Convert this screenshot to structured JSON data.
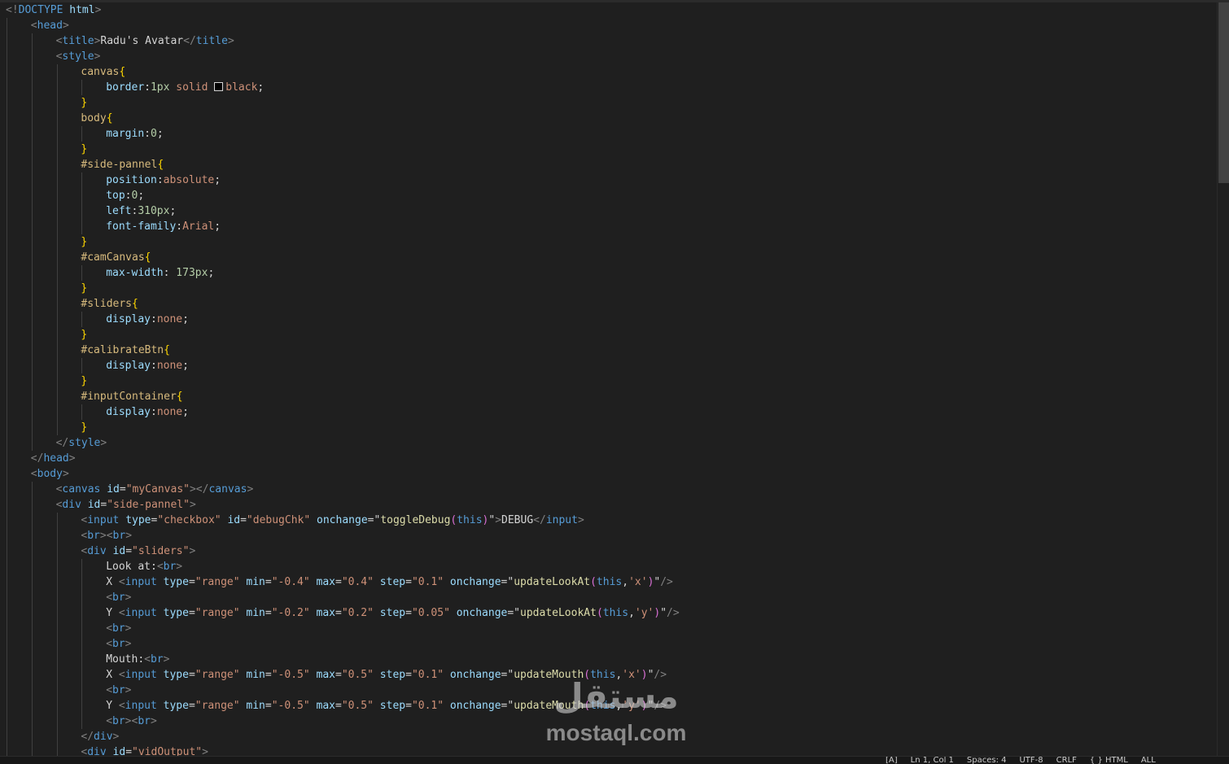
{
  "editor": {
    "lines": [
      [
        [
          "punc",
          "<!"
        ],
        [
          "tag",
          "DOCTYPE"
        ],
        [
          "text",
          " "
        ],
        [
          "attr",
          "html"
        ],
        [
          "punc",
          ">"
        ]
      ],
      [
        [
          "punc",
          "<"
        ],
        [
          "tag",
          "head"
        ],
        [
          "punc",
          ">"
        ]
      ],
      [
        [
          "punc",
          "<"
        ],
        [
          "tag",
          "title"
        ],
        [
          "punc",
          ">"
        ],
        [
          "text",
          "Radu's Avatar"
        ],
        [
          "punc",
          "</"
        ],
        [
          "tag",
          "title"
        ],
        [
          "punc",
          ">"
        ]
      ],
      [
        [
          "punc",
          "<"
        ],
        [
          "tag",
          "style"
        ],
        [
          "punc",
          ">"
        ]
      ],
      [
        [
          "sel",
          "canvas"
        ],
        [
          "brace",
          "{"
        ]
      ],
      [
        [
          "prop",
          "border"
        ],
        [
          "text",
          ":"
        ],
        [
          "num",
          "1px"
        ],
        [
          "text",
          " "
        ],
        [
          "val",
          "solid"
        ],
        [
          "text",
          " "
        ],
        [
          "swatch",
          ""
        ],
        [
          "val",
          "black"
        ],
        [
          "text",
          ";"
        ]
      ],
      [
        [
          "brace",
          "}"
        ]
      ],
      [
        [
          "sel",
          "body"
        ],
        [
          "brace",
          "{"
        ]
      ],
      [
        [
          "prop",
          "margin"
        ],
        [
          "text",
          ":"
        ],
        [
          "num",
          "0"
        ],
        [
          "text",
          ";"
        ]
      ],
      [
        [
          "brace",
          "}"
        ]
      ],
      [
        [
          "sel",
          "#side-pannel"
        ],
        [
          "brace",
          "{"
        ]
      ],
      [
        [
          "prop",
          "position"
        ],
        [
          "text",
          ":"
        ],
        [
          "val",
          "absolute"
        ],
        [
          "text",
          ";"
        ]
      ],
      [
        [
          "prop",
          "top"
        ],
        [
          "text",
          ":"
        ],
        [
          "num",
          "0"
        ],
        [
          "text",
          ";"
        ]
      ],
      [
        [
          "prop",
          "left"
        ],
        [
          "text",
          ":"
        ],
        [
          "num",
          "310px"
        ],
        [
          "text",
          ";"
        ]
      ],
      [
        [
          "prop",
          "font-family"
        ],
        [
          "text",
          ":"
        ],
        [
          "val",
          "Arial"
        ],
        [
          "text",
          ";"
        ]
      ],
      [
        [
          "brace",
          "}"
        ]
      ],
      [
        [
          "sel",
          "#camCanvas"
        ],
        [
          "brace",
          "{"
        ]
      ],
      [
        [
          "prop",
          "max-width"
        ],
        [
          "text",
          ": "
        ],
        [
          "num",
          "173px"
        ],
        [
          "text",
          ";"
        ]
      ],
      [
        [
          "brace",
          "}"
        ]
      ],
      [
        [
          "sel",
          "#sliders"
        ],
        [
          "brace",
          "{"
        ]
      ],
      [
        [
          "prop",
          "display"
        ],
        [
          "text",
          ":"
        ],
        [
          "val",
          "none"
        ],
        [
          "text",
          ";"
        ]
      ],
      [
        [
          "brace",
          "}"
        ]
      ],
      [
        [
          "sel",
          "#calibrateBtn"
        ],
        [
          "brace",
          "{"
        ]
      ],
      [
        [
          "prop",
          "display"
        ],
        [
          "text",
          ":"
        ],
        [
          "val",
          "none"
        ],
        [
          "text",
          ";"
        ]
      ],
      [
        [
          "brace",
          "}"
        ]
      ],
      [
        [
          "sel",
          "#inputContainer"
        ],
        [
          "brace",
          "{"
        ]
      ],
      [
        [
          "prop",
          "display"
        ],
        [
          "text",
          ":"
        ],
        [
          "val",
          "none"
        ],
        [
          "text",
          ";"
        ]
      ],
      [
        [
          "brace",
          "}"
        ]
      ],
      [
        [
          "punc",
          "</"
        ],
        [
          "tag",
          "style"
        ],
        [
          "punc",
          ">"
        ]
      ],
      [
        [
          "punc",
          "</"
        ],
        [
          "tag",
          "head"
        ],
        [
          "punc",
          ">"
        ]
      ],
      [
        [
          "punc",
          "<"
        ],
        [
          "tag",
          "body"
        ],
        [
          "punc",
          ">"
        ]
      ],
      [
        [
          "punc",
          "<"
        ],
        [
          "tag",
          "canvas"
        ],
        [
          "text",
          " "
        ],
        [
          "attr",
          "id"
        ],
        [
          "text",
          "="
        ],
        [
          "str",
          "\"myCanvas\""
        ],
        [
          "punc",
          "></"
        ],
        [
          "tag",
          "canvas"
        ],
        [
          "punc",
          ">"
        ]
      ],
      [
        [
          "punc",
          "<"
        ],
        [
          "tag",
          "div"
        ],
        [
          "text",
          " "
        ],
        [
          "attr",
          "id"
        ],
        [
          "text",
          "="
        ],
        [
          "str",
          "\"side-pannel\""
        ],
        [
          "punc",
          ">"
        ]
      ],
      [
        [
          "punc",
          "<"
        ],
        [
          "tag",
          "input"
        ],
        [
          "text",
          " "
        ],
        [
          "attr",
          "type"
        ],
        [
          "text",
          "="
        ],
        [
          "str",
          "\"checkbox\""
        ],
        [
          "text",
          " "
        ],
        [
          "attr",
          "id"
        ],
        [
          "text",
          "="
        ],
        [
          "str",
          "\"debugChk\""
        ],
        [
          "text",
          " "
        ],
        [
          "attr",
          "onchange"
        ],
        [
          "text",
          "=\""
        ],
        [
          "fn",
          "toggleDebug"
        ],
        [
          "paren",
          "("
        ],
        [
          "kw",
          "this"
        ],
        [
          "paren",
          ")"
        ],
        [
          "text",
          "\""
        ],
        [
          "punc",
          ">"
        ],
        [
          "text",
          "DEBUG"
        ],
        [
          "punc",
          "</"
        ],
        [
          "tag",
          "input"
        ],
        [
          "punc",
          ">"
        ]
      ],
      [
        [
          "punc",
          "<"
        ],
        [
          "tag",
          "br"
        ],
        [
          "punc",
          "><"
        ],
        [
          "tag",
          "br"
        ],
        [
          "punc",
          ">"
        ]
      ],
      [
        [
          "punc",
          "<"
        ],
        [
          "tag",
          "div"
        ],
        [
          "text",
          " "
        ],
        [
          "attr",
          "id"
        ],
        [
          "text",
          "="
        ],
        [
          "str",
          "\"sliders\""
        ],
        [
          "punc",
          ">"
        ]
      ],
      [
        [
          "text",
          "Look at:"
        ],
        [
          "punc",
          "<"
        ],
        [
          "tag",
          "br"
        ],
        [
          "punc",
          ">"
        ]
      ],
      [
        [
          "text",
          "X "
        ],
        [
          "punc",
          "<"
        ],
        [
          "tag",
          "input"
        ],
        [
          "text",
          " "
        ],
        [
          "attr",
          "type"
        ],
        [
          "text",
          "="
        ],
        [
          "str",
          "\"range\""
        ],
        [
          "text",
          " "
        ],
        [
          "attr",
          "min"
        ],
        [
          "text",
          "="
        ],
        [
          "str",
          "\"-0.4\""
        ],
        [
          "text",
          " "
        ],
        [
          "attr",
          "max"
        ],
        [
          "text",
          "="
        ],
        [
          "str",
          "\"0.4\""
        ],
        [
          "text",
          " "
        ],
        [
          "attr",
          "step"
        ],
        [
          "text",
          "="
        ],
        [
          "str",
          "\"0.1\""
        ],
        [
          "text",
          " "
        ],
        [
          "attr",
          "onchange"
        ],
        [
          "text",
          "=\""
        ],
        [
          "fn",
          "updateLookAt"
        ],
        [
          "paren",
          "("
        ],
        [
          "kw",
          "this"
        ],
        [
          "text",
          ","
        ],
        [
          "str",
          "'x'"
        ],
        [
          "paren",
          ")"
        ],
        [
          "text",
          "\""
        ],
        [
          "punc",
          "/>"
        ]
      ],
      [
        [
          "punc",
          "<"
        ],
        [
          "tag",
          "br"
        ],
        [
          "punc",
          ">"
        ]
      ],
      [
        [
          "text",
          "Y "
        ],
        [
          "punc",
          "<"
        ],
        [
          "tag",
          "input"
        ],
        [
          "text",
          " "
        ],
        [
          "attr",
          "type"
        ],
        [
          "text",
          "="
        ],
        [
          "str",
          "\"range\""
        ],
        [
          "text",
          " "
        ],
        [
          "attr",
          "min"
        ],
        [
          "text",
          "="
        ],
        [
          "str",
          "\"-0.2\""
        ],
        [
          "text",
          " "
        ],
        [
          "attr",
          "max"
        ],
        [
          "text",
          "="
        ],
        [
          "str",
          "\"0.2\""
        ],
        [
          "text",
          " "
        ],
        [
          "attr",
          "step"
        ],
        [
          "text",
          "="
        ],
        [
          "str",
          "\"0.05\""
        ],
        [
          "text",
          " "
        ],
        [
          "attr",
          "onchange"
        ],
        [
          "text",
          "=\""
        ],
        [
          "fn",
          "updateLookAt"
        ],
        [
          "paren",
          "("
        ],
        [
          "kw",
          "this"
        ],
        [
          "text",
          ","
        ],
        [
          "str",
          "'y'"
        ],
        [
          "paren",
          ")"
        ],
        [
          "text",
          "\""
        ],
        [
          "punc",
          "/>"
        ]
      ],
      [
        [
          "punc",
          "<"
        ],
        [
          "tag",
          "br"
        ],
        [
          "punc",
          ">"
        ]
      ],
      [
        [
          "punc",
          "<"
        ],
        [
          "tag",
          "br"
        ],
        [
          "punc",
          ">"
        ]
      ],
      [
        [
          "text",
          "Mouth:"
        ],
        [
          "punc",
          "<"
        ],
        [
          "tag",
          "br"
        ],
        [
          "punc",
          ">"
        ]
      ],
      [
        [
          "text",
          "X "
        ],
        [
          "punc",
          "<"
        ],
        [
          "tag",
          "input"
        ],
        [
          "text",
          " "
        ],
        [
          "attr",
          "type"
        ],
        [
          "text",
          "="
        ],
        [
          "str",
          "\"range\""
        ],
        [
          "text",
          " "
        ],
        [
          "attr",
          "min"
        ],
        [
          "text",
          "="
        ],
        [
          "str",
          "\"-0.5\""
        ],
        [
          "text",
          " "
        ],
        [
          "attr",
          "max"
        ],
        [
          "text",
          "="
        ],
        [
          "str",
          "\"0.5\""
        ],
        [
          "text",
          " "
        ],
        [
          "attr",
          "step"
        ],
        [
          "text",
          "="
        ],
        [
          "str",
          "\"0.1\""
        ],
        [
          "text",
          " "
        ],
        [
          "attr",
          "onchange"
        ],
        [
          "text",
          "=\""
        ],
        [
          "fn",
          "updateMouth"
        ],
        [
          "paren",
          "("
        ],
        [
          "kw",
          "this"
        ],
        [
          "text",
          ","
        ],
        [
          "str",
          "'x'"
        ],
        [
          "paren",
          ")"
        ],
        [
          "text",
          "\""
        ],
        [
          "punc",
          "/>"
        ]
      ],
      [
        [
          "punc",
          "<"
        ],
        [
          "tag",
          "br"
        ],
        [
          "punc",
          ">"
        ]
      ],
      [
        [
          "text",
          "Y "
        ],
        [
          "punc",
          "<"
        ],
        [
          "tag",
          "input"
        ],
        [
          "text",
          " "
        ],
        [
          "attr",
          "type"
        ],
        [
          "text",
          "="
        ],
        [
          "str",
          "\"range\""
        ],
        [
          "text",
          " "
        ],
        [
          "attr",
          "min"
        ],
        [
          "text",
          "="
        ],
        [
          "str",
          "\"-0.5\""
        ],
        [
          "text",
          " "
        ],
        [
          "attr",
          "max"
        ],
        [
          "text",
          "="
        ],
        [
          "str",
          "\"0.5\""
        ],
        [
          "text",
          " "
        ],
        [
          "attr",
          "step"
        ],
        [
          "text",
          "="
        ],
        [
          "str",
          "\"0.1\""
        ],
        [
          "text",
          " "
        ],
        [
          "attr",
          "onchange"
        ],
        [
          "text",
          "=\""
        ],
        [
          "fn",
          "updateMouth"
        ],
        [
          "paren",
          "("
        ],
        [
          "kw",
          "this"
        ],
        [
          "text",
          ","
        ],
        [
          "str",
          "'y'"
        ],
        [
          "paren",
          ")"
        ],
        [
          "text",
          "\""
        ],
        [
          "punc",
          "/>"
        ]
      ],
      [
        [
          "punc",
          "<"
        ],
        [
          "tag",
          "br"
        ],
        [
          "punc",
          "><"
        ],
        [
          "tag",
          "br"
        ],
        [
          "punc",
          ">"
        ]
      ],
      [
        [
          "punc",
          "</"
        ],
        [
          "tag",
          "div"
        ],
        [
          "punc",
          ">"
        ]
      ],
      [
        [
          "punc",
          "<"
        ],
        [
          "tag",
          "div"
        ],
        [
          "text",
          " "
        ],
        [
          "attr",
          "id"
        ],
        [
          "text",
          "="
        ],
        [
          "str",
          "\"vidOutput\""
        ],
        [
          "punc",
          ">"
        ]
      ]
    ],
    "indents": [
      0,
      1,
      2,
      2,
      3,
      4,
      3,
      3,
      4,
      3,
      3,
      4,
      4,
      4,
      4,
      3,
      3,
      4,
      3,
      3,
      4,
      3,
      3,
      4,
      3,
      3,
      4,
      3,
      2,
      1,
      1,
      2,
      2,
      3,
      3,
      3,
      4,
      4,
      4,
      4,
      4,
      4,
      4,
      4,
      4,
      4,
      4,
      3,
      3
    ]
  },
  "status": {
    "items": [
      "[A]",
      "Ln 1, Col 1",
      "Spaces: 4",
      "UTF-8",
      "CRLF",
      "{ } HTML",
      "ALL"
    ]
  },
  "watermark": {
    "arabic": "مستقل",
    "latin": "mostaql.com"
  },
  "colors": {
    "background": "#1f1f1f",
    "tag": "#569cd6",
    "attribute": "#9cdcfe",
    "string": "#ce9178",
    "selector": "#d7ba7d",
    "brace": "#ffd700"
  }
}
